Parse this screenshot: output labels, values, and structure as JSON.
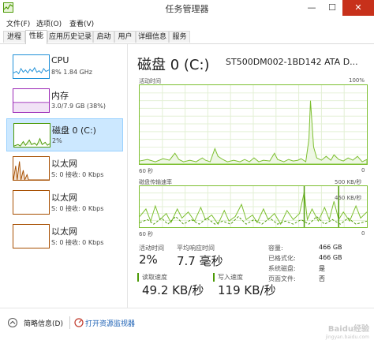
{
  "window": {
    "title": "任务管理器",
    "minimize": "—",
    "maximize": "☐",
    "close": "✕"
  },
  "menu": [
    "文件(F)",
    "选项(O)",
    "查看(V)"
  ],
  "tabs": [
    "进程",
    "性能",
    "应用历史记录",
    "启动",
    "用户",
    "详细信息",
    "服务"
  ],
  "active_tab": "性能",
  "sidebar": {
    "items": [
      {
        "name": "CPU",
        "value": "8% 1.84 GHz",
        "color": "#1f90d8"
      },
      {
        "name": "内存",
        "value": "3.0/7.9 GB (38%)",
        "color": "#9a27b6"
      },
      {
        "name": "磁盘 0 (C:)",
        "value": "2%",
        "color": "#4c9a06"
      },
      {
        "name": "以太网",
        "value": "S: 0 接收: 0 Kbps",
        "color": "#a74f01"
      },
      {
        "name": "以太网",
        "value": "S: 0 接收: 0 Kbps",
        "color": "#a74f01"
      },
      {
        "name": "以太网",
        "value": "S: 0 接收: 0 Kbps",
        "color": "#a74f01"
      }
    ]
  },
  "main": {
    "title": "磁盘 0 (C:)",
    "model": "ST500DM002-1BD142 ATA D...",
    "chart1": {
      "label": "活动时间",
      "max_label": "100%",
      "time_label": "60 秒",
      "min_label": "0"
    },
    "chart2": {
      "label": "磁盘传输速率",
      "max_label": "500 KB/秒",
      "mid_label": "450 KB/秒",
      "time_label": "60 秒",
      "min_label": "0"
    },
    "stats": {
      "active_time": {
        "label": "活动时间",
        "value": "2%"
      },
      "response_time": {
        "label": "平均响应时间",
        "value": "7.7 毫秒"
      },
      "read_speed": {
        "label": "读取速度",
        "value": "49.2 KB/秒"
      },
      "write_speed": {
        "label": "写入速度",
        "value": "119 KB/秒"
      }
    },
    "info": [
      {
        "key": "容量:",
        "value": "466 GB"
      },
      {
        "key": "已格式化:",
        "value": "466 GB"
      },
      {
        "key": "系统磁盘:",
        "value": "是"
      },
      {
        "key": "页面文件:",
        "value": "否"
      }
    ]
  },
  "footer": {
    "brief": "简略信息(D)",
    "open_monitor": "打开资源监视器"
  },
  "watermark": {
    "text": "Baidu经验",
    "sub": "jingyan.baidu.com"
  },
  "accent_color": "#4c9a06"
}
